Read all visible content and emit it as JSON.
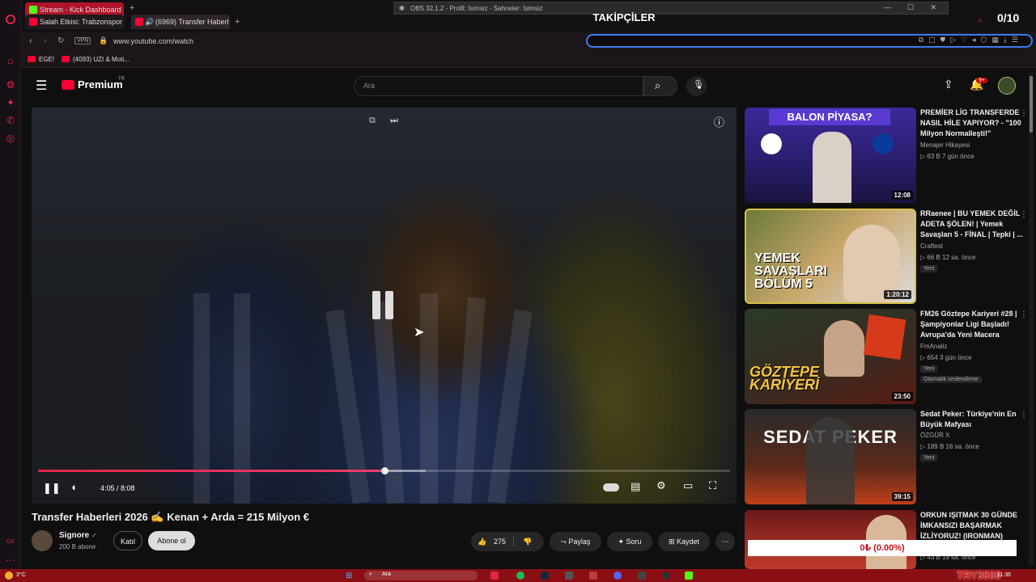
{
  "browser": {
    "tabs": [
      {
        "label": "Stream - Kick Dashboard"
      },
      {
        "label": "Salah Etkisi: Trabzonspor 6"
      },
      {
        "label": "(6969) Transfer Haberl"
      }
    ],
    "obs_title": "OBS 32.1.2 - Profil: İsimsiz - Sahneler: İsimsiz",
    "url": "www.youtube.com/watch",
    "vpn_label": "VPN",
    "bookmarks": [
      "EGE!",
      "(4093) UZI & Moti..."
    ]
  },
  "overlay": {
    "followers_label": "TAKİPÇİLER",
    "followers_count": "0/10",
    "donation": "0₺ (0.00%)",
    "try_label": "TRY3500"
  },
  "youtube": {
    "logo": "Premium",
    "logo_sup": "TR",
    "search_placeholder": "Ara",
    "notif_count": "9+",
    "player": {
      "time": "4:05 / 8:08",
      "progress": 0.5
    },
    "video_title": "Transfer Haberleri 2026 ✍️ Kenan + Arda = 215 Milyon €",
    "channel_name": "Signore",
    "subscribers": "200 B abone",
    "join_label": "Katıl",
    "subscribe_label": "Abone ol",
    "likes": "275",
    "share_label": "Paylaş",
    "ask_label": "Soru",
    "save_label": "Kaydet",
    "recommendations": [
      {
        "thumb_text": "BALON PİYASA?",
        "duration": "12:08",
        "title": "PREMİER LİG TRANSFERDE NASIL HİLE YAPIYOR? - \"100 Milyon Normalleşti!\"",
        "channel": "Menajer Hikayesi",
        "meta": "▷ 63 B   7 gün önce",
        "badge": ""
      },
      {
        "thumb_text": "YEMEK SAVAŞLARI BÖLÜM 5",
        "duration": "1:20:12",
        "title": "RRaenee | BU YEMEK DEĞİL ADETA ŞÖLEN! | Yemek Savaşları 5 - FİNAL | Tepki | ...",
        "channel": "Craftest",
        "meta": "▷ 66 B   12 sa. önce",
        "badge": "Yeni"
      },
      {
        "thumb_text": "GÖZTEPE KARİYERİ",
        "duration": "23:50",
        "title": "FM26 Göztepe Kariyeri #28 | Şampiyonlar Ligi Başladı! Avrupa'da Yeni Macera",
        "channel": "FmAnaliz",
        "meta": "▷ 654   3 gün önce",
        "badge": "Yeni",
        "extra": "Otomatik seslendirme"
      },
      {
        "thumb_text": "SEDAT PEKER",
        "duration": "39:15",
        "title": "Sedat Peker: Türkiye'nin En Büyük Mafyası",
        "channel": "ÖZGÜR X",
        "meta": "▷ 189 B   16 sa. önce",
        "badge": "Yeni"
      },
      {
        "thumb_text": "",
        "duration": "",
        "title": "ORKUN IŞITMAK 30 GÜNDE İMKANSIZI BAŞARMAK İZLİYORUZ! (IRONMAN)",
        "channel": "",
        "meta": "▷ 43 B   19 sa. önce",
        "badge": ""
      }
    ]
  },
  "taskbar": {
    "weather": "3°C",
    "search": "Ara",
    "clock": "11:36"
  },
  "colors": {
    "accent": "#e0264b",
    "yt_red": "#ff0033",
    "taskbar": "#8a0f14"
  }
}
